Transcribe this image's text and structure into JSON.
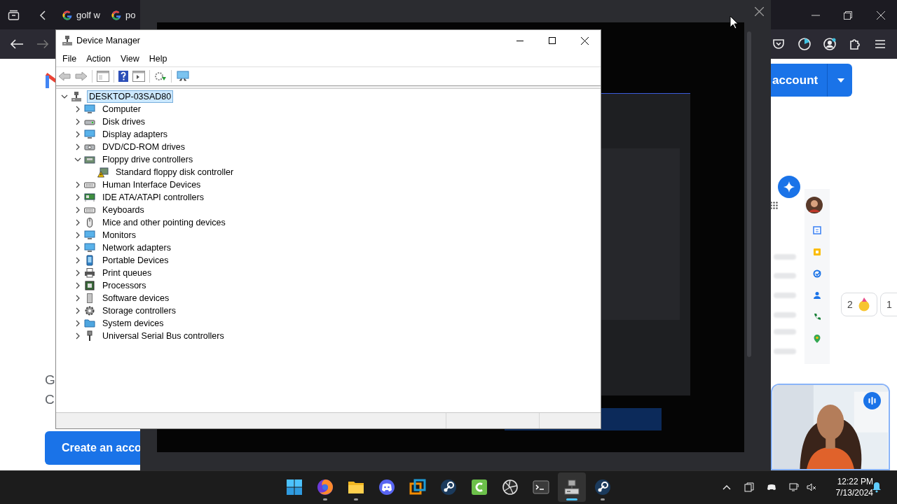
{
  "browser": {
    "tabs": [
      {
        "title": "golf w",
        "selected": false
      },
      {
        "title": "po",
        "selected": false
      }
    ]
  },
  "page": {
    "body": [
      "G",
      "C"
    ],
    "create_button": "Create an acco",
    "header_button": "account",
    "reactions": [
      {
        "count": "2"
      },
      {
        "count": "1"
      }
    ]
  },
  "device_manager": {
    "title": "Device Manager",
    "menu": [
      "File",
      "Action",
      "View",
      "Help"
    ],
    "tree": {
      "label": "DESKTOP-03SAD80",
      "expanded": true,
      "selected": true,
      "children": [
        {
          "label": "Computer",
          "expanded": false,
          "selected": false
        },
        {
          "label": "Disk drives",
          "expanded": false,
          "selected": false
        },
        {
          "label": "Display adapters",
          "expanded": false,
          "selected": false
        },
        {
          "label": "DVD/CD-ROM drives",
          "expanded": false,
          "selected": false
        },
        {
          "label": "Floppy drive controllers",
          "expanded": true,
          "selected": false,
          "children": [
            {
              "label": "Standard floppy disk controller",
              "selected": false,
              "warning": true
            }
          ]
        },
        {
          "label": "Human Interface Devices",
          "expanded": false,
          "selected": false
        },
        {
          "label": "IDE ATA/ATAPI controllers",
          "expanded": false,
          "selected": false
        },
        {
          "label": "Keyboards",
          "expanded": false,
          "selected": false
        },
        {
          "label": "Mice and other pointing devices",
          "expanded": false,
          "selected": false
        },
        {
          "label": "Monitors",
          "expanded": false,
          "selected": false
        },
        {
          "label": "Network adapters",
          "expanded": false,
          "selected": false
        },
        {
          "label": "Portable Devices",
          "expanded": false,
          "selected": false
        },
        {
          "label": "Print queues",
          "expanded": false,
          "selected": false
        },
        {
          "label": "Processors",
          "expanded": false,
          "selected": false
        },
        {
          "label": "Software devices",
          "expanded": false,
          "selected": false
        },
        {
          "label": "Storage controllers",
          "expanded": false,
          "selected": false
        },
        {
          "label": "System devices",
          "expanded": false,
          "selected": false
        },
        {
          "label": "Universal Serial Bus controllers",
          "expanded": false,
          "selected": false
        }
      ]
    }
  },
  "taskbar": {
    "apps": [
      {
        "kind": "start",
        "running": false,
        "active": false
      },
      {
        "kind": "browser",
        "running": true,
        "active": false
      },
      {
        "kind": "folder",
        "running": true,
        "active": false
      },
      {
        "kind": "chat",
        "running": false,
        "active": false
      },
      {
        "kind": "squares",
        "running": false,
        "active": false
      },
      {
        "kind": "valve",
        "running": false,
        "active": false
      },
      {
        "kind": "clapper",
        "running": false,
        "active": false
      },
      {
        "kind": "aperture",
        "running": false,
        "active": false
      },
      {
        "kind": "terminal",
        "running": false,
        "active": false
      },
      {
        "kind": "devices",
        "running": true,
        "active": true
      },
      {
        "kind": "valve",
        "running": true,
        "active": false
      }
    ],
    "time": "12:22 PM",
    "date": "7/13/2024"
  }
}
